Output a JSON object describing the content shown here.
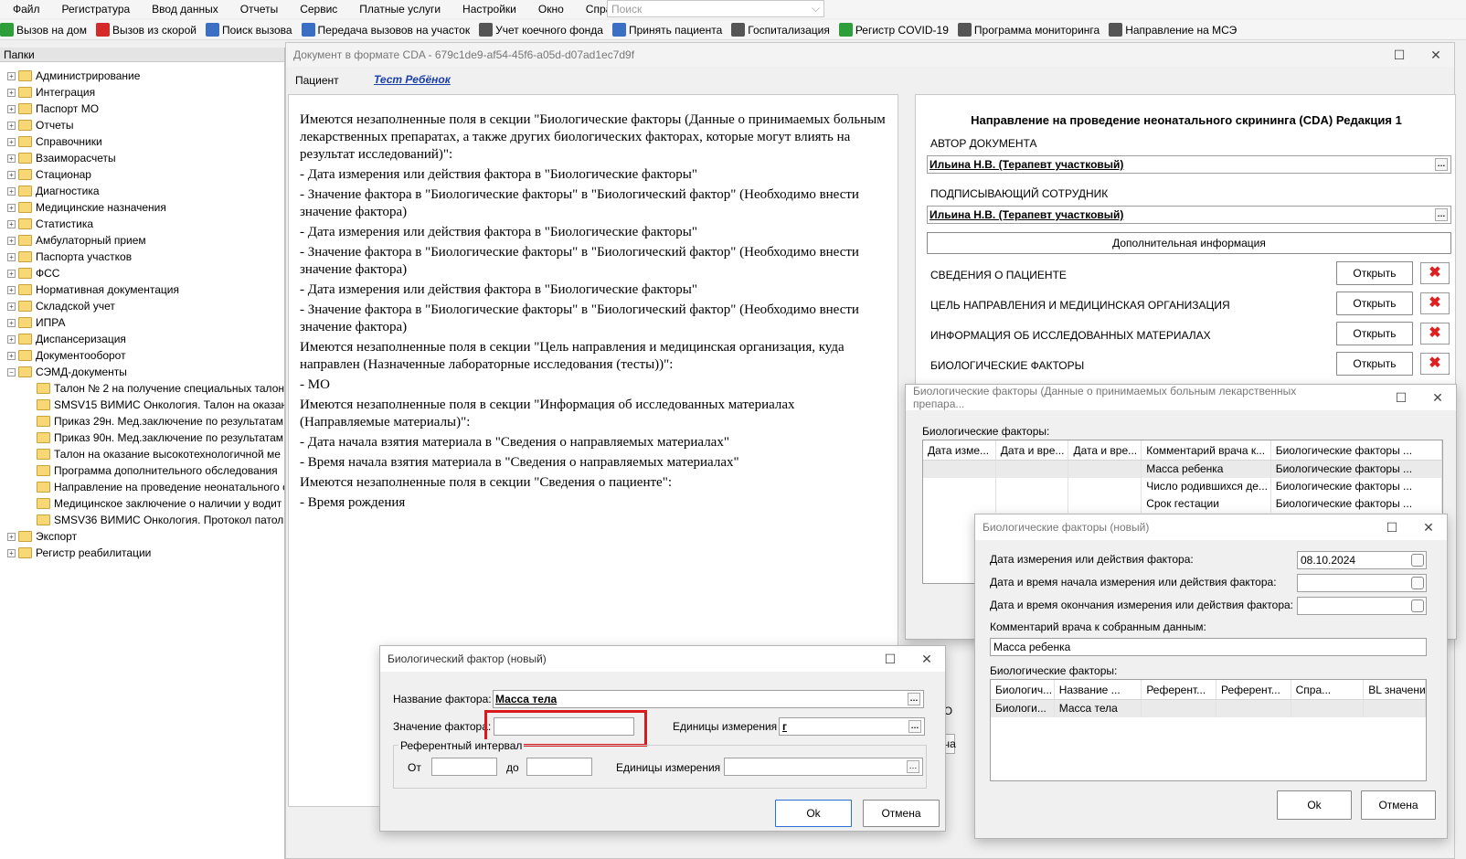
{
  "menu": [
    "Файл",
    "Регистратура",
    "Ввод данных",
    "Отчеты",
    "Сервис",
    "Платные услуги",
    "Настройки",
    "Окно",
    "Справка"
  ],
  "search": {
    "placeholder": "Поиск"
  },
  "toolbar": [
    "Вызов на дом",
    "Вызов из скорой",
    "Поиск вызова",
    "Передача вызовов на участок",
    "Учет коечного фонда",
    "Принять пациента",
    "Госпитализация",
    "Регистр COVID-19",
    "Программа мониторинга",
    "Направление на МСЭ"
  ],
  "sidebar": {
    "header": "Папки",
    "items": [
      {
        "label": "Администрирование",
        "level": 0
      },
      {
        "label": "Интеграция",
        "level": 0
      },
      {
        "label": "Паспорт МО",
        "level": 0
      },
      {
        "label": "Отчеты",
        "level": 0
      },
      {
        "label": "Справочники",
        "level": 0
      },
      {
        "label": "Взаиморасчеты",
        "level": 0
      },
      {
        "label": "Стационар",
        "level": 0
      },
      {
        "label": "Диагностика",
        "level": 0
      },
      {
        "label": "Медицинские назначения",
        "level": 0
      },
      {
        "label": "Статистика",
        "level": 0
      },
      {
        "label": "Амбулаторный прием",
        "level": 0
      },
      {
        "label": "Паспорта участков",
        "level": 0
      },
      {
        "label": "ФСС",
        "level": 0
      },
      {
        "label": "Нормативная документация",
        "level": 0
      },
      {
        "label": "Складской учет",
        "level": 0
      },
      {
        "label": "ИПРА",
        "level": 0
      },
      {
        "label": "Диспансеризация",
        "level": 0
      },
      {
        "label": "Документооборот",
        "level": 0
      },
      {
        "label": "СЭМД-документы",
        "level": 0
      },
      {
        "label": "Талон № 2 на получение специальных талон",
        "level": 1
      },
      {
        "label": "SMSV15 ВИМИС Онкология. Талон на оказани",
        "level": 1
      },
      {
        "label": "Приказ 29н. Мед.заключение по результатам",
        "level": 1
      },
      {
        "label": "Приказ 90н. Мед.заключение по результатам",
        "level": 1
      },
      {
        "label": "Талон на оказание высокотехнологичной ме",
        "level": 1
      },
      {
        "label": "Программа дополнительного обследования",
        "level": 1
      },
      {
        "label": "Направление на проведение неонатального с",
        "level": 1
      },
      {
        "label": "Медицинское заключение о наличии у водит",
        "level": 1
      },
      {
        "label": "SMSV36 ВИМИС Онкология. Протокол патол",
        "level": 1
      },
      {
        "label": "Экспорт",
        "level": 0
      },
      {
        "label": "Регистр реабилитации",
        "level": 0
      }
    ]
  },
  "cda": {
    "title": "Документ в формате CDA - 679c1de9-af54-45f6-a05d-d07ad1ec7d9f",
    "patient_label": "Пациент",
    "patient_name": "Тест Ребёнок",
    "doc_lines": [
      "Имеются незаполненные поля в секции \"Биологические факторы (Данные о принимаемых больным лекарственных препаратах, а также других биологических факторах, которые могут влиять на результат исследований)\":",
      "- Дата измерения или действия фактора в \"Биологические факторы\"",
      "- Значение фактора в \"Биологические факторы\" в \"Биологический фактор\" (Необходимо внести значение фактора)",
      "- Дата измерения или действия фактора в \"Биологические факторы\"",
      "- Значение фактора в \"Биологические факторы\" в \"Биологический фактор\" (Необходимо внести значение фактора)",
      "- Дата измерения или действия фактора в \"Биологические факторы\"",
      "- Значение фактора в \"Биологические факторы\" в \"Биологический фактор\" (Необходимо внести значение фактора)",
      "Имеются незаполненные поля в секции \"Цель направления и медицинская организация, куда направлен (Назначенные лабораторные исследования (тесты))\":",
      "- МО",
      "Имеются незаполненные поля в секции \"Информация об исследованных материалах (Направляемые материалы)\":",
      "- Дата начала взятия материала в \"Сведения о направляемых материалах\"",
      "- Время начала взятия материала в \"Сведения о направляемых материалах\"",
      "Имеются незаполненные поля в секции \"Сведения о пациенте\":",
      "- Время рождения"
    ],
    "form_title": "Направление на проведение неонатального скрининга (CDA) Редакция 1",
    "author_label": "АВТОР ДОКУМЕНТА",
    "author_value": "Ильина Н.В. (Терапевт участковый)",
    "signer_label": "ПОДПИСЫВАЮЩИЙ СОТРУДНИК",
    "signer_value": "Ильина Н.В. (Терапевт участковый)",
    "extra_btn": "Дополнительная информация",
    "sections": [
      "СВЕДЕНИЯ О ПАЦИЕНТЕ",
      "ЦЕЛЬ НАПРАВЛЕНИЯ И МЕДИЦИНСКАЯ ОРГАНИЗАЦИЯ",
      "ИНФОРМАЦИЯ ОБ ИССЛЕДОВАННЫХ МАТЕРИАЛАХ",
      "БИОЛОГИЧЕСКИЕ ФАКТОРЫ"
    ],
    "open_label": "Открыть",
    "partial_a": "А СО",
    "partial_b": "Печа"
  },
  "bio_list": {
    "title": "Биологические факторы (Данные о принимаемых больным лекарственных препара...",
    "grid_label": "Биологические факторы:",
    "cols": [
      "Дата изме...",
      "Дата и вре...",
      "Дата и вре...",
      "Комментарий врача к...",
      "Биологические факторы ..."
    ],
    "rows": [
      [
        "",
        "",
        "",
        "Масса ребенка",
        "Биологические факторы ..."
      ],
      [
        "",
        "",
        "",
        "Число родившихся де...",
        "Биологические факторы ..."
      ],
      [
        "",
        "",
        "",
        "Срок гестации",
        "Биологические факторы ..."
      ]
    ]
  },
  "bio_new": {
    "title": "Биологические факторы (новый)",
    "date_label": "Дата измерения или действия фактора:",
    "date_value": "08.10.2024",
    "start_label": "Дата и время начала измерения или действия фактора:",
    "end_label": "Дата и время окончания измерения или действия фактора:",
    "comment_label": "Комментарий врача к собранным данным:",
    "comment_value": "Масса ребенка",
    "grid_label": "Биологические факторы:",
    "cols": [
      "Биологич...",
      "Название ...",
      "Референт...",
      "Референт...",
      "Спра...",
      "BL значение"
    ],
    "rows": [
      [
        "Биологи...",
        "Масса тела",
        "",
        "",
        "",
        ""
      ]
    ],
    "ok": "Ok",
    "cancel": "Отмена"
  },
  "factor": {
    "title": "Биологический фактор (новый)",
    "name_label": "Название фактора:",
    "name_value": "Масса тела",
    "value_label": "Значение фактора:",
    "value_value": "",
    "units_label": "Единицы измерения",
    "units_value": "г",
    "ref_label": "Референтный интервал",
    "from_label": "От",
    "to_label": "до",
    "ref_units_label": "Единицы измерения",
    "ok": "Ok",
    "cancel": "Отмена"
  }
}
